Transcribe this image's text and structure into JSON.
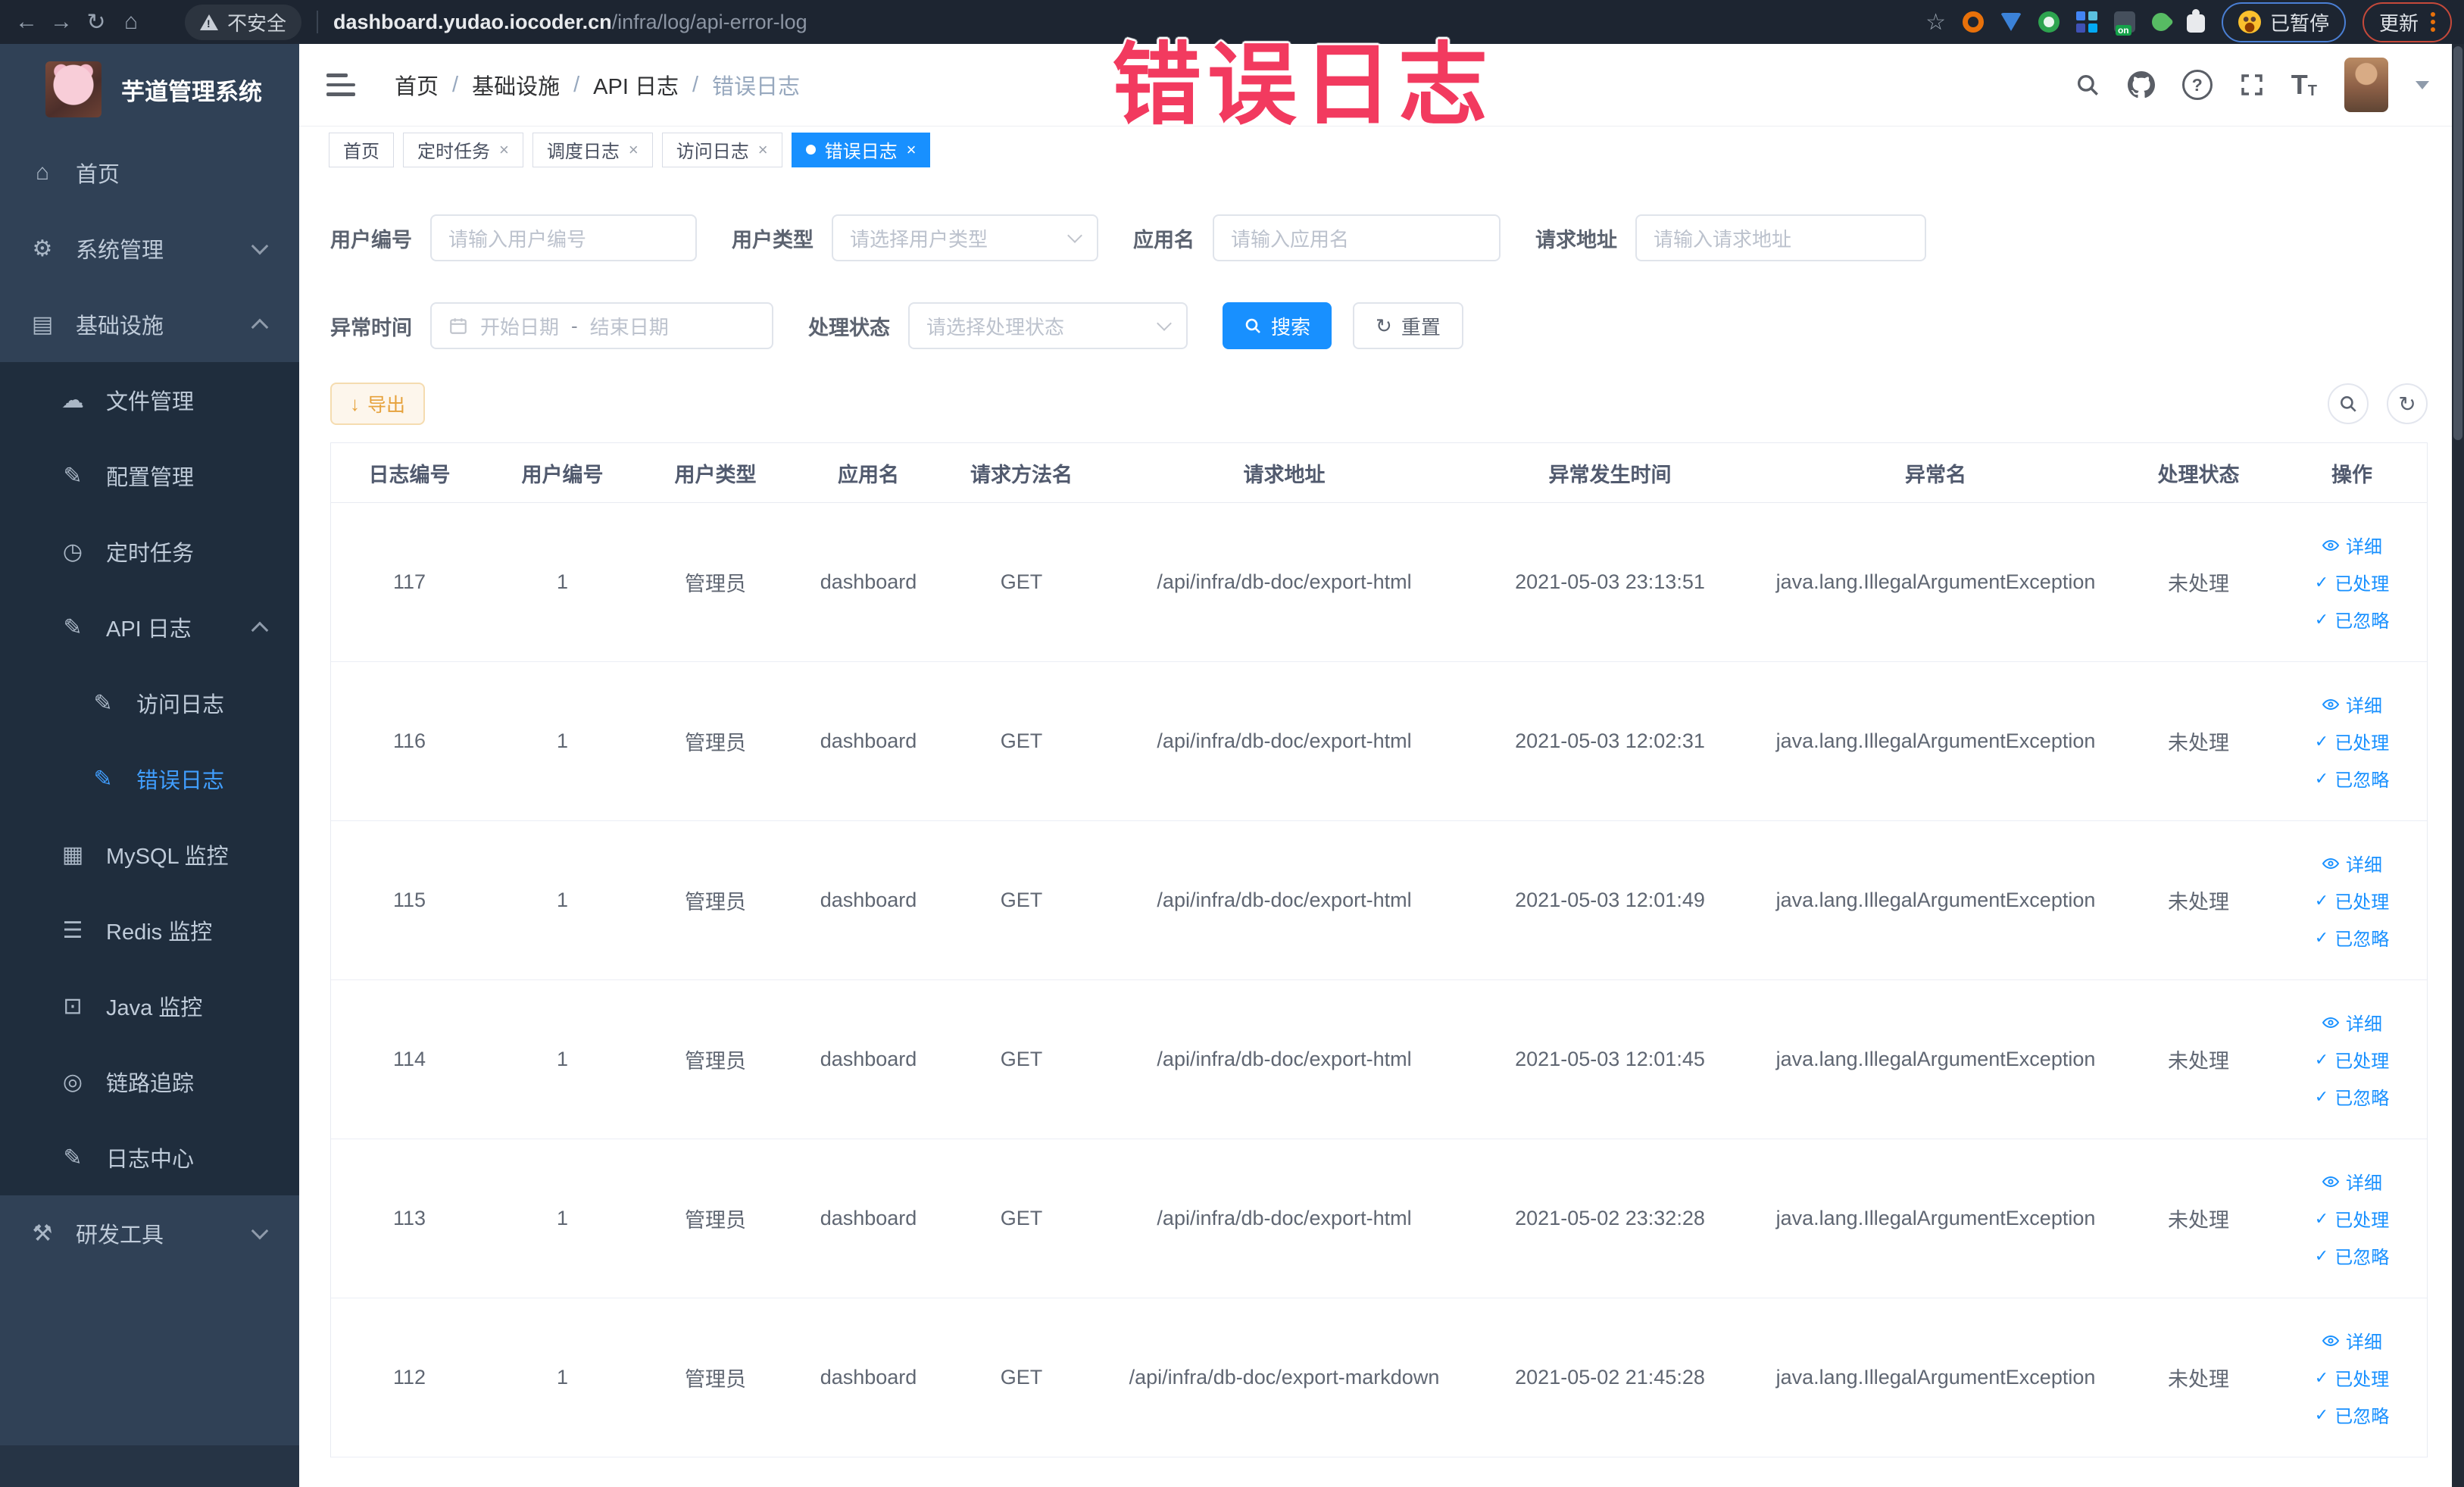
{
  "browser": {
    "security_label": "不安全",
    "url_domain": "dashboard.yudao.iocoder.cn",
    "url_path": "/infra/log/api-error-log",
    "paused_label": "已暂停",
    "update_label": "更新"
  },
  "watermark": {
    "text": "错误日志"
  },
  "colors": {
    "accent": "#1890ff",
    "active_tag": "#1890ff",
    "sidebar_bg": "#304156",
    "sidebar_submenu_bg": "#1f2d3d",
    "warning": "#e6a23c",
    "watermark": "#f23a5f",
    "browser_bar": "#1d2531"
  },
  "sidebar": {
    "title": "芋道管理系统",
    "items": [
      {
        "label": "首页",
        "icon": "dashboard",
        "level": 0
      },
      {
        "label": "系统管理",
        "icon": "gear",
        "level": 0,
        "chevron": "down"
      },
      {
        "label": "基础设施",
        "icon": "infra",
        "level": 0,
        "chevron": "up"
      },
      {
        "label": "文件管理",
        "icon": "cloud",
        "level": 1,
        "dark": true
      },
      {
        "label": "配置管理",
        "icon": "edit",
        "level": 1,
        "dark": true
      },
      {
        "label": "定时任务",
        "icon": "clock",
        "level": 1,
        "dark": true
      },
      {
        "label": "API 日志",
        "icon": "log",
        "level": 1,
        "dark": true,
        "chevron": "up"
      },
      {
        "label": "访问日志",
        "icon": "log",
        "level": 2,
        "dark": true
      },
      {
        "label": "错误日志",
        "icon": "log",
        "level": 2,
        "dark": true,
        "active": true
      },
      {
        "label": "MySQL 监控",
        "icon": "chart",
        "level": 1,
        "dark": true
      },
      {
        "label": "Redis 监控",
        "icon": "layers",
        "level": 1,
        "dark": true
      },
      {
        "label": "Java 监控",
        "icon": "monitor",
        "level": 1,
        "dark": true
      },
      {
        "label": "链路追踪",
        "icon": "eye",
        "level": 1,
        "dark": true
      },
      {
        "label": "日志中心",
        "icon": "log",
        "level": 1,
        "dark": true
      },
      {
        "label": "研发工具",
        "icon": "tool",
        "level": 0,
        "chevron": "down"
      }
    ]
  },
  "breadcrumb": [
    "首页",
    "基础设施",
    "API 日志",
    "错误日志"
  ],
  "tabs": [
    {
      "label": "首页",
      "closable": false,
      "active": false
    },
    {
      "label": "定时任务",
      "closable": true,
      "active": false
    },
    {
      "label": "调度日志",
      "closable": true,
      "active": false
    },
    {
      "label": "访问日志",
      "closable": true,
      "active": false
    },
    {
      "label": "错误日志",
      "closable": true,
      "active": true
    }
  ],
  "filters": {
    "user_id": {
      "label": "用户编号",
      "placeholder": "请输入用户编号"
    },
    "user_type": {
      "label": "用户类型",
      "placeholder": "请选择用户类型"
    },
    "app_name": {
      "label": "应用名",
      "placeholder": "请输入应用名"
    },
    "request_url": {
      "label": "请求地址",
      "placeholder": "请输入请求地址"
    },
    "exception_time": {
      "label": "异常时间",
      "start_placeholder": "开始日期",
      "separator": "-",
      "end_placeholder": "结束日期"
    },
    "process_status": {
      "label": "处理状态",
      "placeholder": "请选择处理状态"
    },
    "search_label": "搜索",
    "reset_label": "重置"
  },
  "toolbar": {
    "export_label": "导出"
  },
  "table": {
    "headers": [
      "日志编号",
      "用户编号",
      "用户类型",
      "应用名",
      "请求方法名",
      "请求地址",
      "异常发生时间",
      "异常名",
      "处理状态",
      "操作"
    ],
    "actions": [
      {
        "label": "详细",
        "icon": "eye"
      },
      {
        "label": "已处理",
        "icon": "check"
      },
      {
        "label": "已忽略",
        "icon": "check"
      }
    ],
    "rows": [
      {
        "log_id": "117",
        "user_id": "1",
        "user_type": "管理员",
        "app_name": "dashboard",
        "method": "GET",
        "url": "/api/infra/db-doc/export-html",
        "time": "2021-05-03 23:13:51",
        "exception": "java.lang.IllegalArgumentException",
        "status": "未处理"
      },
      {
        "log_id": "116",
        "user_id": "1",
        "user_type": "管理员",
        "app_name": "dashboard",
        "method": "GET",
        "url": "/api/infra/db-doc/export-html",
        "time": "2021-05-03 12:02:31",
        "exception": "java.lang.IllegalArgumentException",
        "status": "未处理"
      },
      {
        "log_id": "115",
        "user_id": "1",
        "user_type": "管理员",
        "app_name": "dashboard",
        "method": "GET",
        "url": "/api/infra/db-doc/export-html",
        "time": "2021-05-03 12:01:49",
        "exception": "java.lang.IllegalArgumentException",
        "status": "未处理"
      },
      {
        "log_id": "114",
        "user_id": "1",
        "user_type": "管理员",
        "app_name": "dashboard",
        "method": "GET",
        "url": "/api/infra/db-doc/export-html",
        "time": "2021-05-03 12:01:45",
        "exception": "java.lang.IllegalArgumentException",
        "status": "未处理"
      },
      {
        "log_id": "113",
        "user_id": "1",
        "user_type": "管理员",
        "app_name": "dashboard",
        "method": "GET",
        "url": "/api/infra/db-doc/export-html",
        "time": "2021-05-02 23:32:28",
        "exception": "java.lang.IllegalArgumentException",
        "status": "未处理"
      },
      {
        "log_id": "112",
        "user_id": "1",
        "user_type": "管理员",
        "app_name": "dashboard",
        "method": "GET",
        "url": "/api/infra/db-doc/export-markdown",
        "time": "2021-05-02 21:45:28",
        "exception": "java.lang.IllegalArgumentException",
        "status": "未处理"
      }
    ]
  }
}
